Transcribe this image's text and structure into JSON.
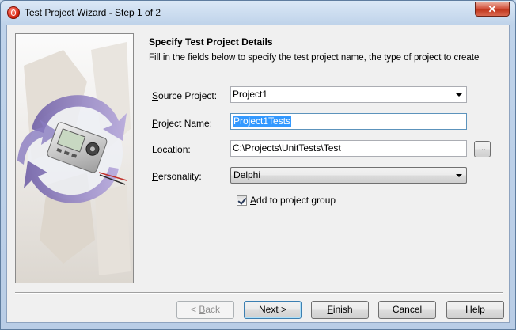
{
  "window": {
    "title": "Test Project Wizard - Step 1 of 2",
    "close_glyph": "✕"
  },
  "page": {
    "heading": "Specify Test Project Details",
    "description": "Fill in the fields below to specify the test project name, the type of project to create"
  },
  "form": {
    "source_project": {
      "label_u": "S",
      "label_rest": "ource Project:",
      "value": "Project1"
    },
    "project_name": {
      "label_u": "P",
      "label_rest": "roject Name:",
      "value": "Project1Tests"
    },
    "location": {
      "label_u": "L",
      "label_rest": "ocation:",
      "value": "C:\\Projects\\UnitTests\\Test",
      "browse_label": "..."
    },
    "personality": {
      "label_u": "P",
      "label_rest": "ersonality:",
      "value": "Delphi"
    },
    "add_to_group": {
      "label_u": "A",
      "label_rest": "dd to project group",
      "checked": true
    }
  },
  "buttons": {
    "back": {
      "prefix": "< ",
      "u": "B",
      "rest": "ack"
    },
    "next": "Next >",
    "finish": {
      "u": "F",
      "rest": "inish"
    },
    "cancel": "Cancel",
    "help": "Help"
  },
  "illustration": {
    "icon": "unit-test-device-illustration"
  },
  "colors": {
    "selection": "#3399ff",
    "close": "#c1381f",
    "frame": "#b9cde6"
  }
}
